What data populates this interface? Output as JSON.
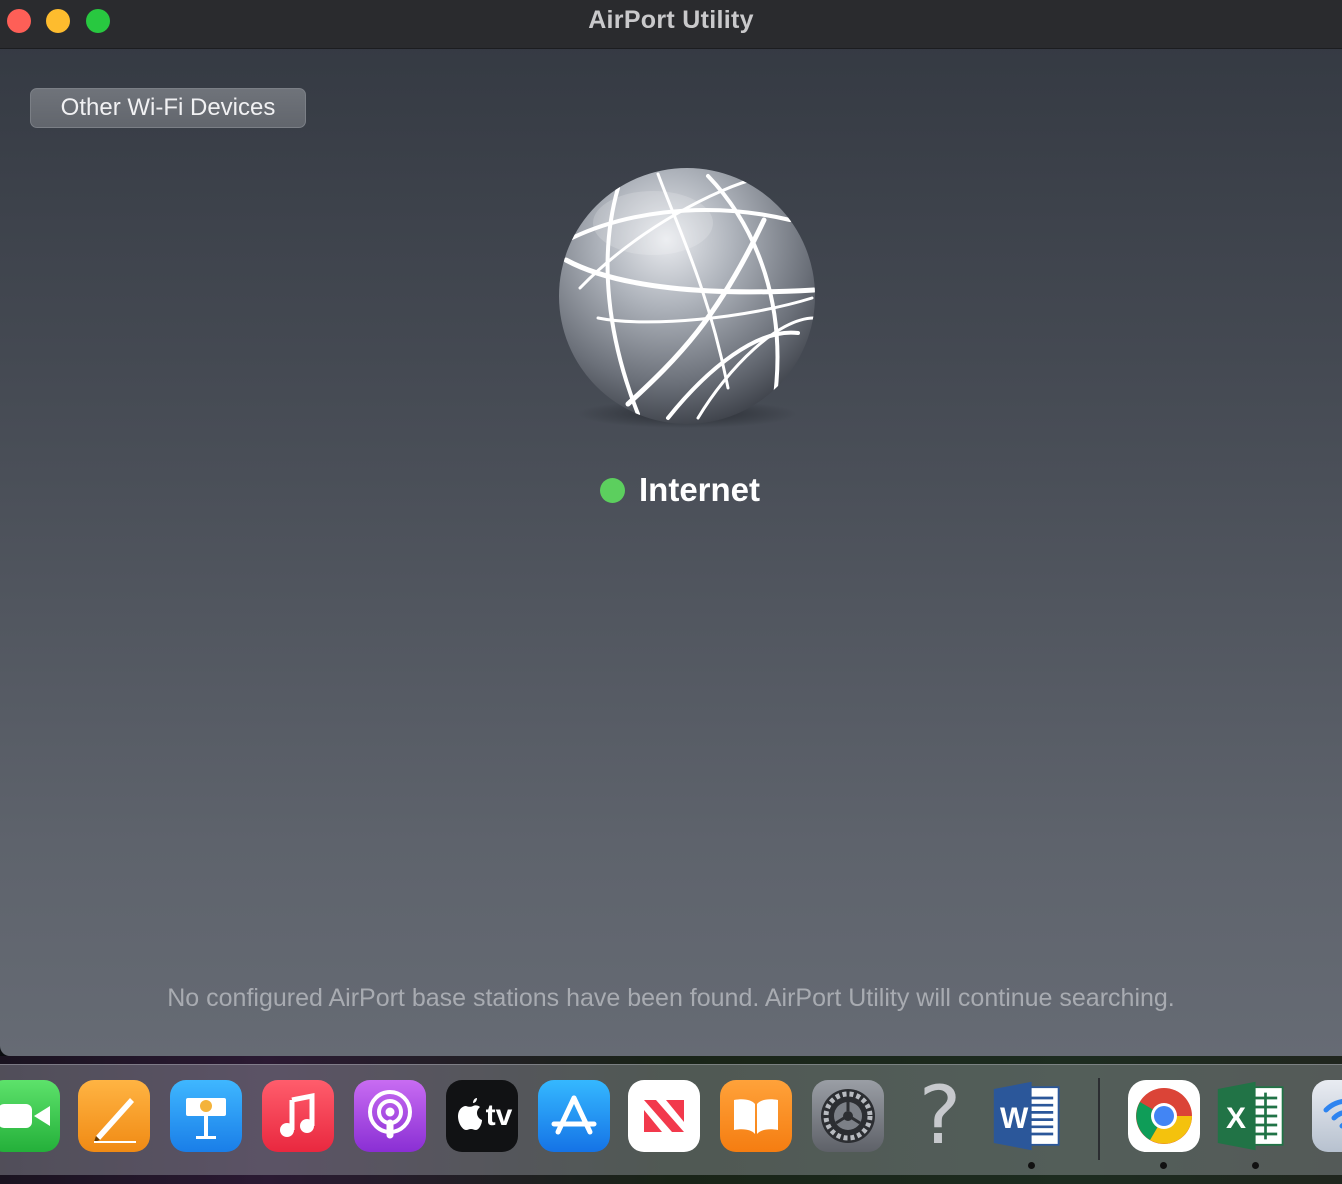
{
  "window": {
    "title": "AirPort Utility"
  },
  "toolbar": {
    "other_devices_label": "Other Wi-Fi Devices"
  },
  "internet": {
    "label": "Internet",
    "status_color": "#5ccf5e"
  },
  "status_message": "No configured AirPort base stations have been found. AirPort Utility will continue searching.",
  "dock": {
    "items": [
      {
        "name": "facetime-icon"
      },
      {
        "name": "pages-icon"
      },
      {
        "name": "keynote-icon"
      },
      {
        "name": "music-icon"
      },
      {
        "name": "podcasts-icon"
      },
      {
        "name": "apple-tv-icon",
        "label": "tv"
      },
      {
        "name": "app-store-icon"
      },
      {
        "name": "news-icon"
      },
      {
        "name": "books-icon"
      },
      {
        "name": "system-preferences-icon"
      },
      {
        "name": "help-question-icon",
        "label": "?"
      },
      {
        "name": "microsoft-word-icon",
        "label": "W"
      },
      {
        "name": "google-chrome-icon"
      },
      {
        "name": "microsoft-excel-icon",
        "label": "X"
      },
      {
        "name": "wifi-diagnostics-icon"
      }
    ]
  }
}
